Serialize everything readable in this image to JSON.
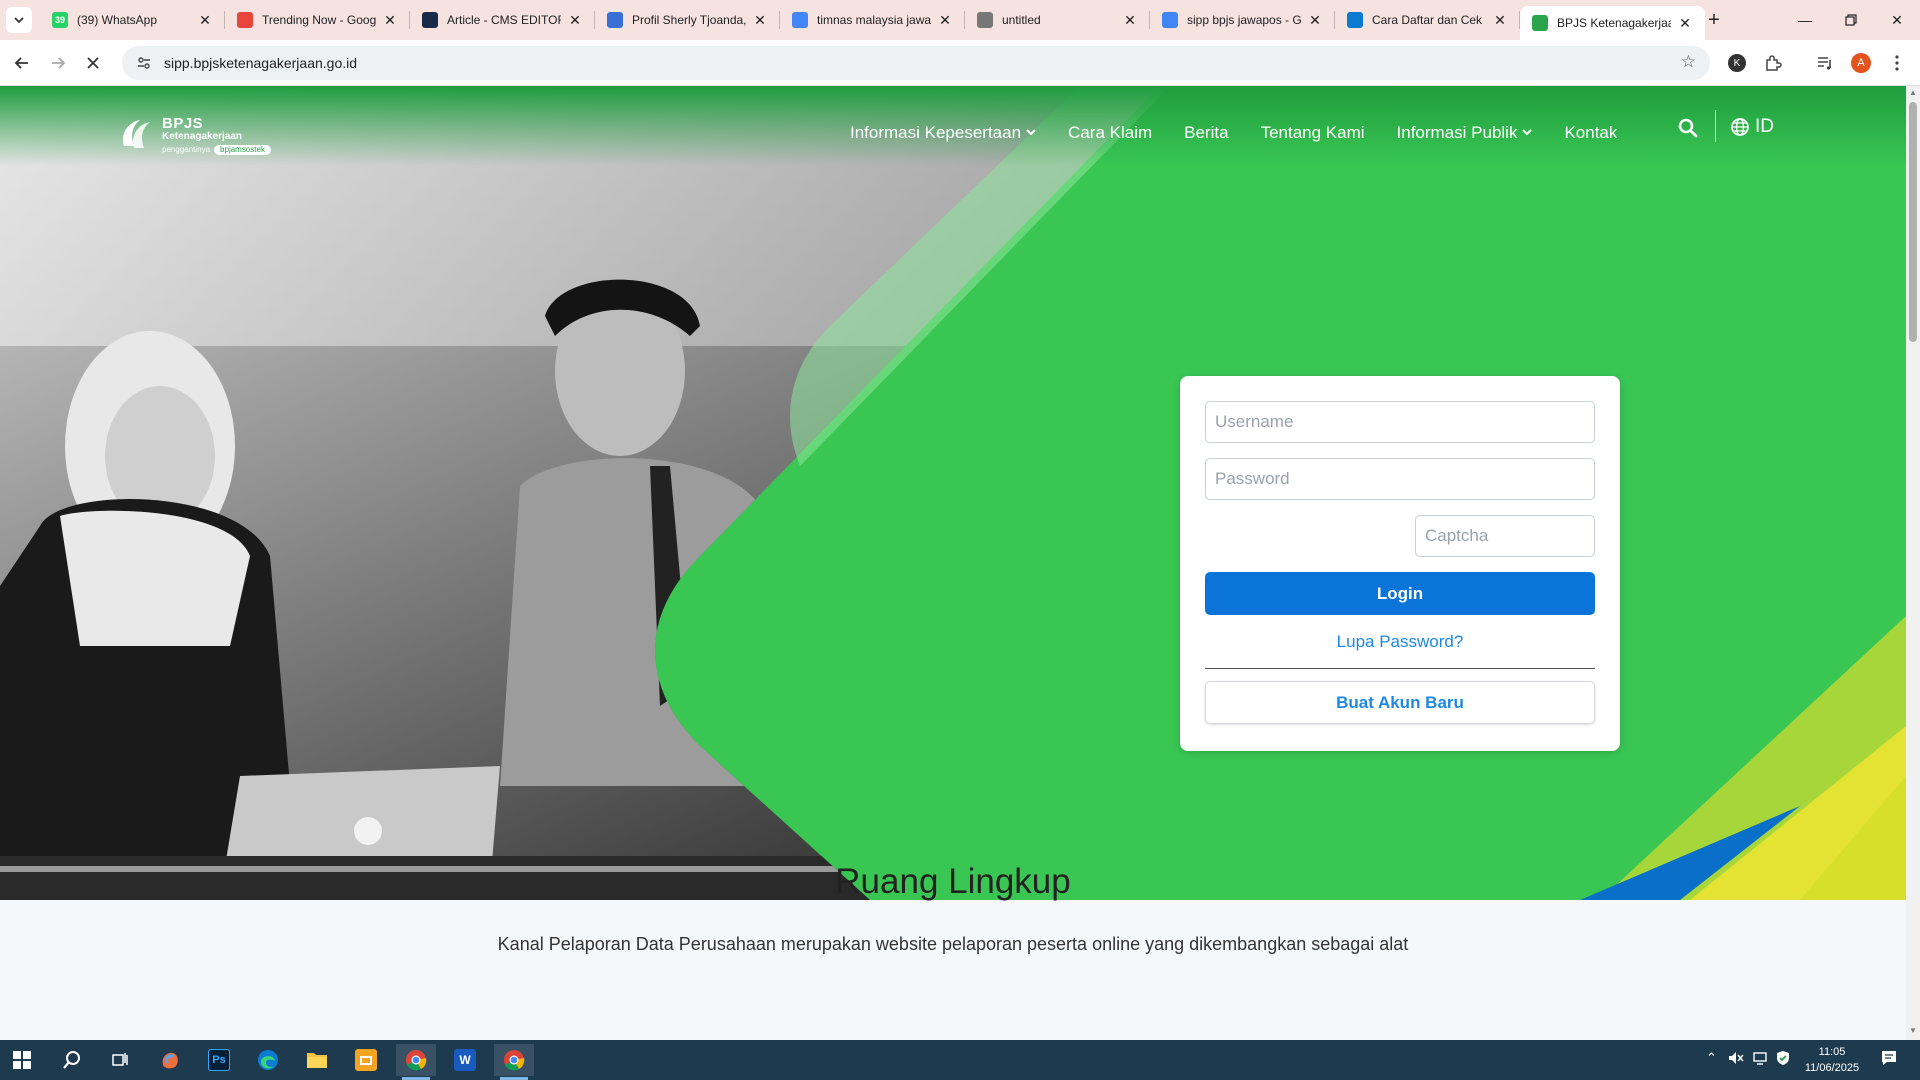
{
  "browser": {
    "tabs": [
      {
        "title": "(39) WhatsApp",
        "favicon": "whatsapp-icon",
        "color": "#25D366",
        "badge": "39"
      },
      {
        "title": "Trending Now - Goog",
        "favicon": "trending-icon",
        "color": "#e8453c"
      },
      {
        "title": "Article - CMS EDITOR",
        "favicon": "cms-icon",
        "color": "#1a2b49"
      },
      {
        "title": "Profil Sherly Tjoanda,",
        "favicon": "bookmark-icon",
        "color": "#3a6fd8"
      },
      {
        "title": "timnas malaysia jawa",
        "favicon": "google-icon",
        "color": "#4285F4"
      },
      {
        "title": "untitled",
        "favicon": "globe-icon",
        "color": "#777777"
      },
      {
        "title": "sipp bpjs jawapos - G",
        "favicon": "google-icon",
        "color": "#4285F4"
      },
      {
        "title": "Cara Daftar dan Cek S",
        "favicon": "k-icon",
        "color": "#0a7bd1"
      },
      {
        "title": "BPJS Ketenagakerjaan",
        "favicon": "bpjs-icon",
        "color": "#2aa44a",
        "active": true
      }
    ],
    "address": "sipp.bpjsketenagakerjaan.go.id",
    "profile_initial": "A",
    "extension_initial": "K"
  },
  "site": {
    "logo": {
      "line1": "BPJS",
      "line2": "Ketenagakerjaan",
      "line3_prefix": "penggantinya",
      "line3_pill": "bpjamsostek"
    },
    "menu": [
      {
        "label": "Informasi Kepesertaan",
        "dropdown": true
      },
      {
        "label": "Cara Klaim",
        "dropdown": false
      },
      {
        "label": "Berita",
        "dropdown": false
      },
      {
        "label": "Tentang Kami",
        "dropdown": false
      },
      {
        "label": "Informasi Publik",
        "dropdown": true
      },
      {
        "label": "Kontak",
        "dropdown": false
      }
    ],
    "language": "ID",
    "brand_green": "#39c653",
    "brand_blue": "#0a74d9"
  },
  "login": {
    "username_placeholder": "Username",
    "password_placeholder": "Password",
    "captcha_placeholder": "Captcha",
    "login_label": "Login",
    "forgot_label": "Lupa Password?",
    "register_label": "Buat Akun Baru"
  },
  "section": {
    "title": "Ruang Lingkup",
    "text": "Kanal Pelaporan Data Perusahaan merupakan website pelaporan peserta online yang dikembangkan sebagai alat"
  },
  "taskbar": {
    "time": "11:05",
    "date": "11/06/2025",
    "apps": [
      "start-icon",
      "search-icon",
      "task-view-icon",
      "copilot-icon",
      "photoshop-icon",
      "edge-icon",
      "file-explorer-icon",
      "slides-icon",
      "chrome-icon",
      "word-icon",
      "chrome-icon"
    ]
  }
}
